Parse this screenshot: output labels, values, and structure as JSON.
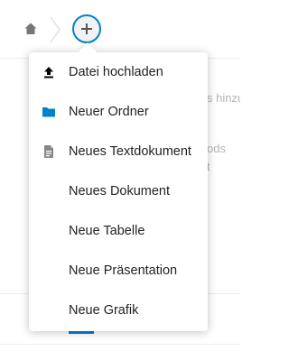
{
  "breadcrumb": {
    "home_icon": "home-icon",
    "add_icon": "plus-icon"
  },
  "background": {
    "hint_line_1": "s hinzu",
    "hint_line_2": "ods",
    "hint_line_3": "t"
  },
  "new_menu": {
    "items": [
      {
        "label": "Datei hochladen",
        "icon": "upload-icon"
      },
      {
        "label": "Neuer Ordner",
        "icon": "folder-icon"
      },
      {
        "label": "Neues Textdokument",
        "icon": "text-document-icon"
      },
      {
        "label": "Neues Dokument",
        "icon": ""
      },
      {
        "label": "Neue Tabelle",
        "icon": ""
      },
      {
        "label": "Neue Präsentation",
        "icon": ""
      },
      {
        "label": "Neue Grafik",
        "icon": ""
      }
    ]
  },
  "colors": {
    "accent": "#0082c9",
    "text": "#222222",
    "icon_gray": "#888888",
    "muted": "#b4b4b4"
  }
}
